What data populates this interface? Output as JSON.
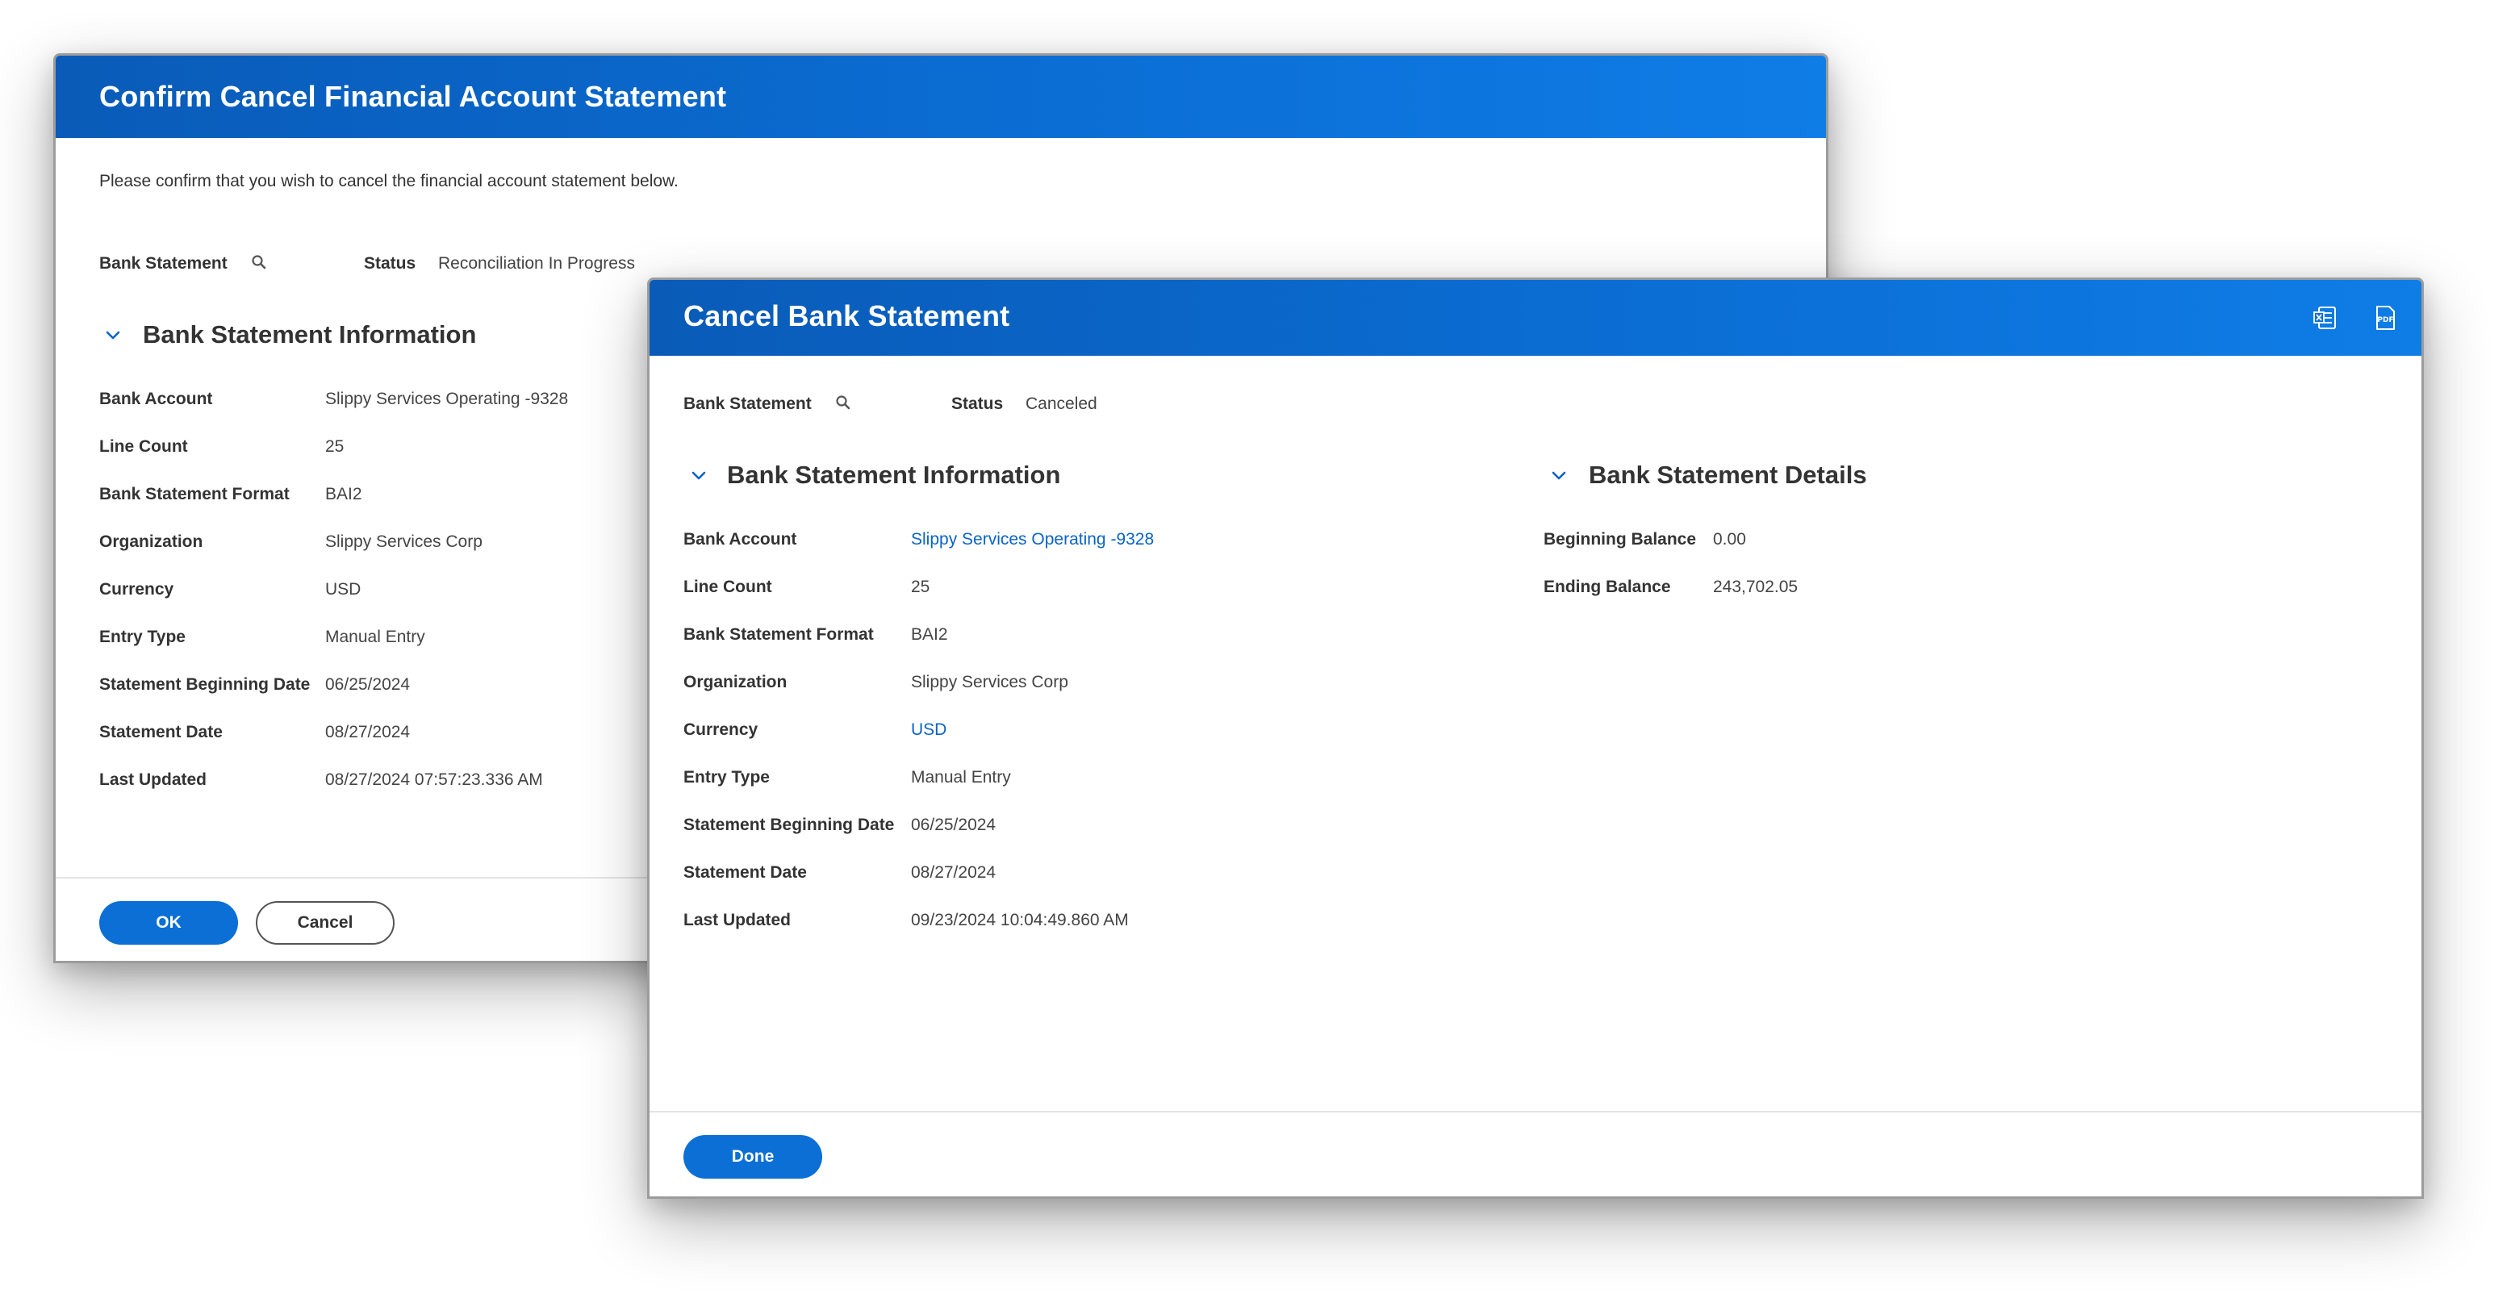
{
  "confirm_dialog": {
    "title": "Confirm Cancel Financial Account Statement",
    "intro": "Please confirm that you wish to cancel the financial account statement below.",
    "bank_statement_label": "Bank Statement",
    "status_label": "Status",
    "status_value": "Reconciliation In Progress",
    "section_title": "Bank Statement Information",
    "fields": [
      {
        "label": "Bank Account",
        "value": "Slippy Services Operating -9328"
      },
      {
        "label": "Line Count",
        "value": "25"
      },
      {
        "label": "Bank Statement Format",
        "value": "BAI2"
      },
      {
        "label": "Organization",
        "value": "Slippy Services Corp"
      },
      {
        "label": "Currency",
        "value": "USD"
      },
      {
        "label": "Entry Type",
        "value": "Manual Entry"
      },
      {
        "label": "Statement Beginning Date",
        "value": "06/25/2024"
      },
      {
        "label": "Statement Date",
        "value": "08/27/2024"
      },
      {
        "label": "Last Updated",
        "value": "08/27/2024 07:57:23.336 AM"
      }
    ],
    "ok_label": "OK",
    "cancel_label": "Cancel"
  },
  "result_dialog": {
    "title": "Cancel Bank Statement",
    "bank_statement_label": "Bank Statement",
    "status_label": "Status",
    "status_value": "Canceled",
    "info_section_title": "Bank Statement Information",
    "info_fields": [
      {
        "label": "Bank Account",
        "value": "Slippy Services Operating -9328",
        "link": true
      },
      {
        "label": "Line Count",
        "value": "25",
        "link": false
      },
      {
        "label": "Bank Statement Format",
        "value": "BAI2",
        "link": false
      },
      {
        "label": "Organization",
        "value": "Slippy Services Corp",
        "link": false
      },
      {
        "label": "Currency",
        "value": "USD",
        "link": true
      },
      {
        "label": "Entry Type",
        "value": "Manual Entry",
        "link": false
      },
      {
        "label": "Statement Beginning Date",
        "value": "06/25/2024",
        "link": false
      },
      {
        "label": "Statement Date",
        "value": "08/27/2024",
        "link": false
      },
      {
        "label": "Last Updated",
        "value": "09/23/2024 10:04:49.860 AM",
        "link": false
      }
    ],
    "details_section_title": "Bank Statement Details",
    "details_fields": [
      {
        "label": "Beginning Balance",
        "value": "0.00"
      },
      {
        "label": "Ending Balance",
        "value": "243,702.05"
      }
    ],
    "done_label": "Done",
    "export_excel_icon": "excel-export-icon",
    "export_pdf_icon": "pdf-export-icon",
    "pdf_icon_text": "PDF"
  },
  "colors": {
    "header_blue": "#0b6fd6",
    "link_blue": "#0a63c9",
    "primary_button": "#0b6fd6"
  }
}
